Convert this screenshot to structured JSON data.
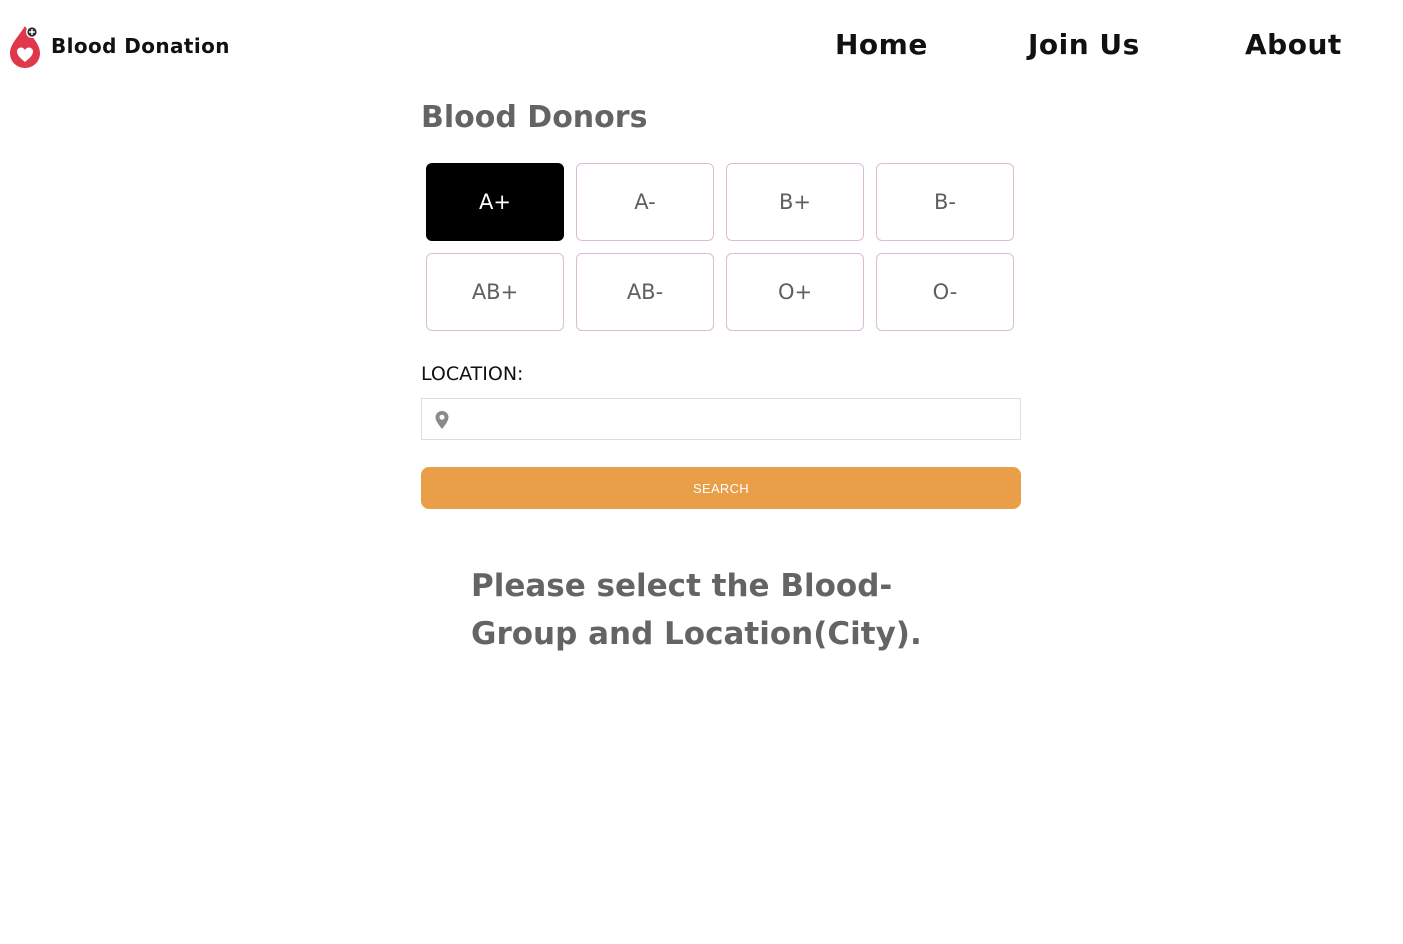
{
  "brand": {
    "name": "Blood Donation",
    "logo_icon": "blood-drop-heart-icon",
    "logo_color": "#e0374a"
  },
  "nav": {
    "links": [
      {
        "label": "Home"
      },
      {
        "label": "Join Us"
      },
      {
        "label": "About"
      }
    ]
  },
  "main": {
    "title": "Blood Donors",
    "blood_groups": [
      {
        "label": "A+",
        "selected": true
      },
      {
        "label": "A-",
        "selected": false
      },
      {
        "label": "B+",
        "selected": false
      },
      {
        "label": "B-",
        "selected": false
      },
      {
        "label": "AB+",
        "selected": false
      },
      {
        "label": "AB-",
        "selected": false
      },
      {
        "label": "O+",
        "selected": false
      },
      {
        "label": "O-",
        "selected": false
      }
    ],
    "location": {
      "label": "LOCATION:",
      "value": "",
      "placeholder": "",
      "icon": "map-pin-icon"
    },
    "search_button": "SEARCH",
    "message": "Please select the Blood-Group and Location(City)."
  },
  "colors": {
    "accent": "#e99e48",
    "selected_bg": "#000000",
    "button_border": "#dbbcd6",
    "heading_text": "#646464"
  }
}
